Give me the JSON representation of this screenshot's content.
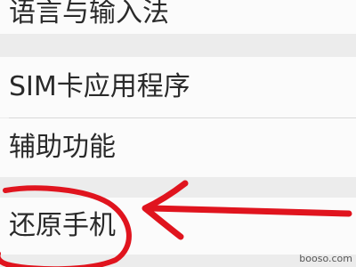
{
  "settings": {
    "items": [
      {
        "label": "语言与输入法"
      },
      {
        "label": "SIM卡应用程序"
      },
      {
        "label": "辅助功能"
      },
      {
        "label": "还原手机"
      }
    ]
  },
  "annotation": {
    "color": "#e0141e"
  },
  "watermark": {
    "text": "booso.com"
  }
}
